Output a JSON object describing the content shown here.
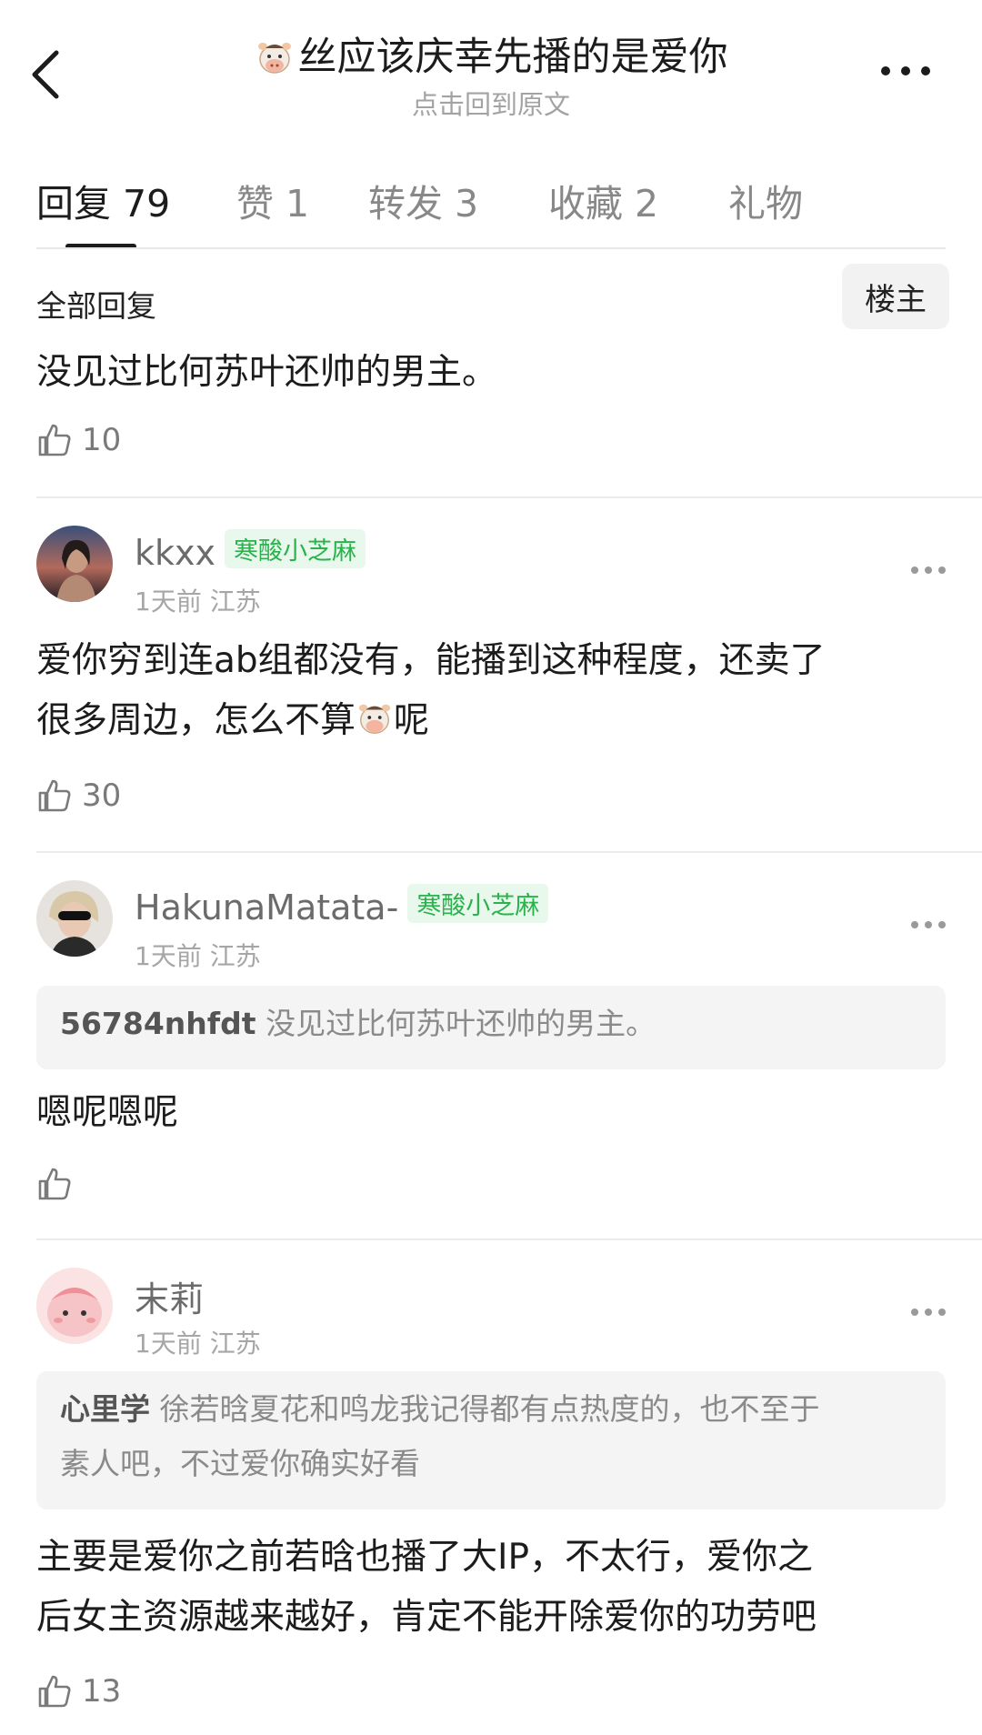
{
  "header": {
    "title": "丝应该庆幸先播的是爱你",
    "subtitle": "点击回到原文",
    "title_icon": "cow-emoji"
  },
  "tabs": [
    {
      "label": "回复",
      "count": "79",
      "active": true
    },
    {
      "label": "赞",
      "count": "1"
    },
    {
      "label": "转发",
      "count": "3"
    },
    {
      "label": "收藏",
      "count": "2"
    },
    {
      "label": "礼物",
      "count": ""
    }
  ],
  "section": {
    "label": "全部回复",
    "op_button": "楼主"
  },
  "top_post": {
    "text": "没见过比何苏叶还帅的男主。",
    "likes": "10"
  },
  "comments": [
    {
      "user": "kkxx",
      "badge": "寒酸小芝麻",
      "time": "1天前",
      "location": "江苏",
      "text_line1": "爱你穷到连ab组都没有，能播到这种程度，还卖了",
      "text_line2_before": "很多周边，怎么不算",
      "text_line2_after": "呢",
      "likes": "30"
    },
    {
      "user": "HakunaMatata-",
      "badge": "寒酸小芝麻",
      "time": "1天前",
      "location": "江苏",
      "quote_user": "56784nhfdt",
      "quote_text": "没见过比何苏叶还帅的男主。",
      "text": "嗯呢嗯呢",
      "likes": ""
    },
    {
      "user": "末莉",
      "time": "1天前",
      "location": "江苏",
      "quote_user": "心里学",
      "quote_text_line1": "徐若晗夏花和鸣龙我记得都有点热度的，也不至于",
      "quote_text_line2": "素人吧，不过爱你确实好看",
      "text_line1": "主要是爱你之前若晗也播了大IP，不太行，爱你之",
      "text_line2": "后女主资源越来越好，肯定不能开除爱你的功劳吧",
      "likes": "13"
    }
  ],
  "colors": {
    "badge_green": "#2bb24c",
    "badge_bg": "#e9f8ec",
    "muted": "#a6a6a6"
  }
}
